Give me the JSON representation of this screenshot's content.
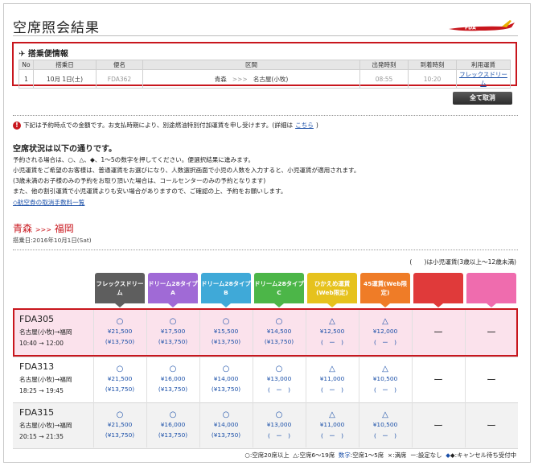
{
  "page": {
    "title": "空席照会結果",
    "logo_text": "FDA"
  },
  "flight_info": {
    "heading": "搭乗便情報",
    "columns": [
      "No",
      "搭乗日",
      "便名",
      "区間",
      "出発時刻",
      "到着時刻",
      "利用運賃"
    ],
    "row": {
      "no": "1",
      "date": "10月 1日(土)",
      "flight": "FDA362",
      "from": "青森",
      "arrow": ">>>",
      "to": "名古屋(小牧)",
      "dep": "08:55",
      "arr": "10:20",
      "fare": "フレックスドリーム"
    }
  },
  "buttons": {
    "cancel_all": "全て取消"
  },
  "notice": {
    "text": "下記は予約時点での金額です。お支払時期により、別途燃油特別付加運賃を申し受けます。(詳細は",
    "link": "こちら",
    "tail": ")"
  },
  "status": {
    "title": "空席状況は以下の通りです。",
    "lines": [
      "予約される場合は、○、△、◆、1〜5の数字を押してください。便選択結果に進みます。",
      "小児運賃をご希望のお客様は、普通運賃をお選びになり、人数選択画面で小児の人数を入力すると、小児運賃が適用されます。",
      "(3歳未満のお子様のみの予約をお取り頂いた場合は、コールセンターのみの予約となります)",
      "また、他の割引運賃で小児運賃よりも安い場合がありますので、ご確認の上、予約をお願いします。"
    ],
    "link": "◇航空券の取消手数料一覧"
  },
  "route": {
    "from": "青森",
    "sep": ">>>",
    "to": "福岡",
    "boarding_date": "搭乗日:2016年10月1日(Sat)"
  },
  "child_note": "(　　)は小児運賃(3歳以上〜12歳未満)",
  "fares": [
    {
      "label": "フレックスドリーム",
      "color": "#5e5e5e"
    },
    {
      "label": "ドリーム28タイプA",
      "color": "#a06ad6"
    },
    {
      "label": "ドリーム28タイプB",
      "color": "#3fa9d8"
    },
    {
      "label": "ドリーム28タイプC",
      "color": "#4cb648"
    },
    {
      "label": "ひかえめ運賃(Web限定)",
      "color": "#e6c21d"
    },
    {
      "label": "45運賃(Web限定)",
      "color": "#ef7c27"
    },
    {
      "label": "",
      "color": "#e03a3a"
    },
    {
      "label": "",
      "color": "#ef6cae"
    }
  ],
  "flights": [
    {
      "no": "FDA305",
      "route": "名古屋(小牧)→福岡",
      "time": "10:40 → 12:00",
      "cells": [
        {
          "mark": "○",
          "price": "¥21,500",
          "child": "(¥13,750)"
        },
        {
          "mark": "○",
          "price": "¥17,500",
          "child": "(¥13,750)"
        },
        {
          "mark": "○",
          "price": "¥15,500",
          "child": "(¥13,750)"
        },
        {
          "mark": "○",
          "price": "¥14,500",
          "child": "(¥13,750)"
        },
        {
          "mark": "△",
          "price": "¥12,500",
          "child": "(　ー　)"
        },
        {
          "mark": "△",
          "price": "¥12,000",
          "child": "(　ー　)"
        },
        {
          "dash": "ー"
        },
        {
          "dash": "ー"
        }
      ]
    },
    {
      "no": "FDA313",
      "route": "名古屋(小牧)→福岡",
      "time": "18:25 → 19:45",
      "cells": [
        {
          "mark": "○",
          "price": "¥21,500",
          "child": "(¥13,750)"
        },
        {
          "mark": "○",
          "price": "¥16,000",
          "child": "(¥13,750)"
        },
        {
          "mark": "○",
          "price": "¥14,000",
          "child": "(¥13,750)"
        },
        {
          "mark": "○",
          "price": "¥13,000",
          "child": "(　ー　)"
        },
        {
          "mark": "△",
          "price": "¥11,000",
          "child": "(　ー　)"
        },
        {
          "mark": "△",
          "price": "¥10,500",
          "child": "(　ー　)"
        },
        {
          "dash": "ー"
        },
        {
          "dash": "ー"
        }
      ]
    },
    {
      "no": "FDA315",
      "route": "名古屋(小牧)→福岡",
      "time": "20:15 → 21:35",
      "cells": [
        {
          "mark": "○",
          "price": "¥21,500",
          "child": "(¥13,750)"
        },
        {
          "mark": "○",
          "price": "¥16,000",
          "child": "(¥13,750)"
        },
        {
          "mark": "○",
          "price": "¥14,000",
          "child": "(¥13,750)"
        },
        {
          "mark": "○",
          "price": "¥13,000",
          "child": "(　ー　)"
        },
        {
          "mark": "△",
          "price": "¥11,000",
          "child": "(　ー　)"
        },
        {
          "mark": "△",
          "price": "¥10,500",
          "child": "(　ー　)"
        },
        {
          "dash": "ー"
        },
        {
          "dash": "ー"
        }
      ]
    }
  ],
  "legend": {
    "a": "○:空席20席以上",
    "b": "△:空席6〜19席",
    "c": "数字",
    "d": ":空席1〜5席",
    "e": "×:満席",
    "f": "ー:設定なし",
    "g": "◆:キャンセル待ち受付中"
  }
}
